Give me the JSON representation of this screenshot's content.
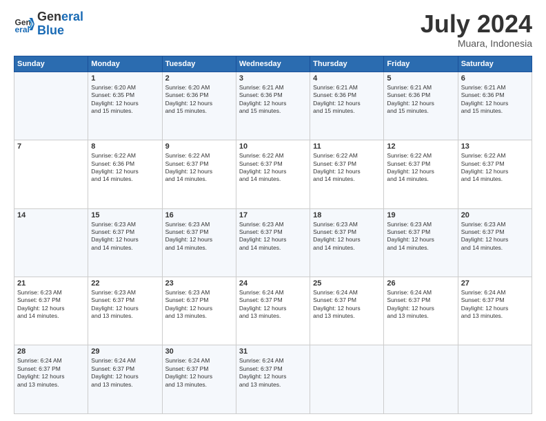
{
  "logo": {
    "line1": "General",
    "line2": "Blue"
  },
  "title": "July 2024",
  "location": "Muara, Indonesia",
  "days_of_week": [
    "Sunday",
    "Monday",
    "Tuesday",
    "Wednesday",
    "Thursday",
    "Friday",
    "Saturday"
  ],
  "weeks": [
    [
      {
        "day": "",
        "info": ""
      },
      {
        "day": "1",
        "info": "Sunrise: 6:20 AM\nSunset: 6:35 PM\nDaylight: 12 hours\nand 15 minutes."
      },
      {
        "day": "2",
        "info": "Sunrise: 6:20 AM\nSunset: 6:36 PM\nDaylight: 12 hours\nand 15 minutes."
      },
      {
        "day": "3",
        "info": "Sunrise: 6:21 AM\nSunset: 6:36 PM\nDaylight: 12 hours\nand 15 minutes."
      },
      {
        "day": "4",
        "info": "Sunrise: 6:21 AM\nSunset: 6:36 PM\nDaylight: 12 hours\nand 15 minutes."
      },
      {
        "day": "5",
        "info": "Sunrise: 6:21 AM\nSunset: 6:36 PM\nDaylight: 12 hours\nand 15 minutes."
      },
      {
        "day": "6",
        "info": "Sunrise: 6:21 AM\nSunset: 6:36 PM\nDaylight: 12 hours\nand 15 minutes."
      }
    ],
    [
      {
        "day": "7",
        "info": ""
      },
      {
        "day": "8",
        "info": "Sunrise: 6:22 AM\nSunset: 6:36 PM\nDaylight: 12 hours\nand 14 minutes."
      },
      {
        "day": "9",
        "info": "Sunrise: 6:22 AM\nSunset: 6:37 PM\nDaylight: 12 hours\nand 14 minutes."
      },
      {
        "day": "10",
        "info": "Sunrise: 6:22 AM\nSunset: 6:37 PM\nDaylight: 12 hours\nand 14 minutes."
      },
      {
        "day": "11",
        "info": "Sunrise: 6:22 AM\nSunset: 6:37 PM\nDaylight: 12 hours\nand 14 minutes."
      },
      {
        "day": "12",
        "info": "Sunrise: 6:22 AM\nSunset: 6:37 PM\nDaylight: 12 hours\nand 14 minutes."
      },
      {
        "day": "13",
        "info": "Sunrise: 6:22 AM\nSunset: 6:37 PM\nDaylight: 12 hours\nand 14 minutes."
      }
    ],
    [
      {
        "day": "14",
        "info": ""
      },
      {
        "day": "15",
        "info": "Sunrise: 6:23 AM\nSunset: 6:37 PM\nDaylight: 12 hours\nand 14 minutes."
      },
      {
        "day": "16",
        "info": "Sunrise: 6:23 AM\nSunset: 6:37 PM\nDaylight: 12 hours\nand 14 minutes."
      },
      {
        "day": "17",
        "info": "Sunrise: 6:23 AM\nSunset: 6:37 PM\nDaylight: 12 hours\nand 14 minutes."
      },
      {
        "day": "18",
        "info": "Sunrise: 6:23 AM\nSunset: 6:37 PM\nDaylight: 12 hours\nand 14 minutes."
      },
      {
        "day": "19",
        "info": "Sunrise: 6:23 AM\nSunset: 6:37 PM\nDaylight: 12 hours\nand 14 minutes."
      },
      {
        "day": "20",
        "info": "Sunrise: 6:23 AM\nSunset: 6:37 PM\nDaylight: 12 hours\nand 14 minutes."
      }
    ],
    [
      {
        "day": "21",
        "info": "Sunrise: 6:23 AM\nSunset: 6:37 PM\nDaylight: 12 hours\nand 14 minutes."
      },
      {
        "day": "22",
        "info": "Sunrise: 6:23 AM\nSunset: 6:37 PM\nDaylight: 12 hours\nand 13 minutes."
      },
      {
        "day": "23",
        "info": "Sunrise: 6:23 AM\nSunset: 6:37 PM\nDaylight: 12 hours\nand 13 minutes."
      },
      {
        "day": "24",
        "info": "Sunrise: 6:24 AM\nSunset: 6:37 PM\nDaylight: 12 hours\nand 13 minutes."
      },
      {
        "day": "25",
        "info": "Sunrise: 6:24 AM\nSunset: 6:37 PM\nDaylight: 12 hours\nand 13 minutes."
      },
      {
        "day": "26",
        "info": "Sunrise: 6:24 AM\nSunset: 6:37 PM\nDaylight: 12 hours\nand 13 minutes."
      },
      {
        "day": "27",
        "info": "Sunrise: 6:24 AM\nSunset: 6:37 PM\nDaylight: 12 hours\nand 13 minutes."
      }
    ],
    [
      {
        "day": "28",
        "info": "Sunrise: 6:24 AM\nSunset: 6:37 PM\nDaylight: 12 hours\nand 13 minutes."
      },
      {
        "day": "29",
        "info": "Sunrise: 6:24 AM\nSunset: 6:37 PM\nDaylight: 12 hours\nand 13 minutes."
      },
      {
        "day": "30",
        "info": "Sunrise: 6:24 AM\nSunset: 6:37 PM\nDaylight: 12 hours\nand 13 minutes."
      },
      {
        "day": "31",
        "info": "Sunrise: 6:24 AM\nSunset: 6:37 PM\nDaylight: 12 hours\nand 13 minutes."
      },
      {
        "day": "",
        "info": ""
      },
      {
        "day": "",
        "info": ""
      },
      {
        "day": "",
        "info": ""
      }
    ]
  ]
}
